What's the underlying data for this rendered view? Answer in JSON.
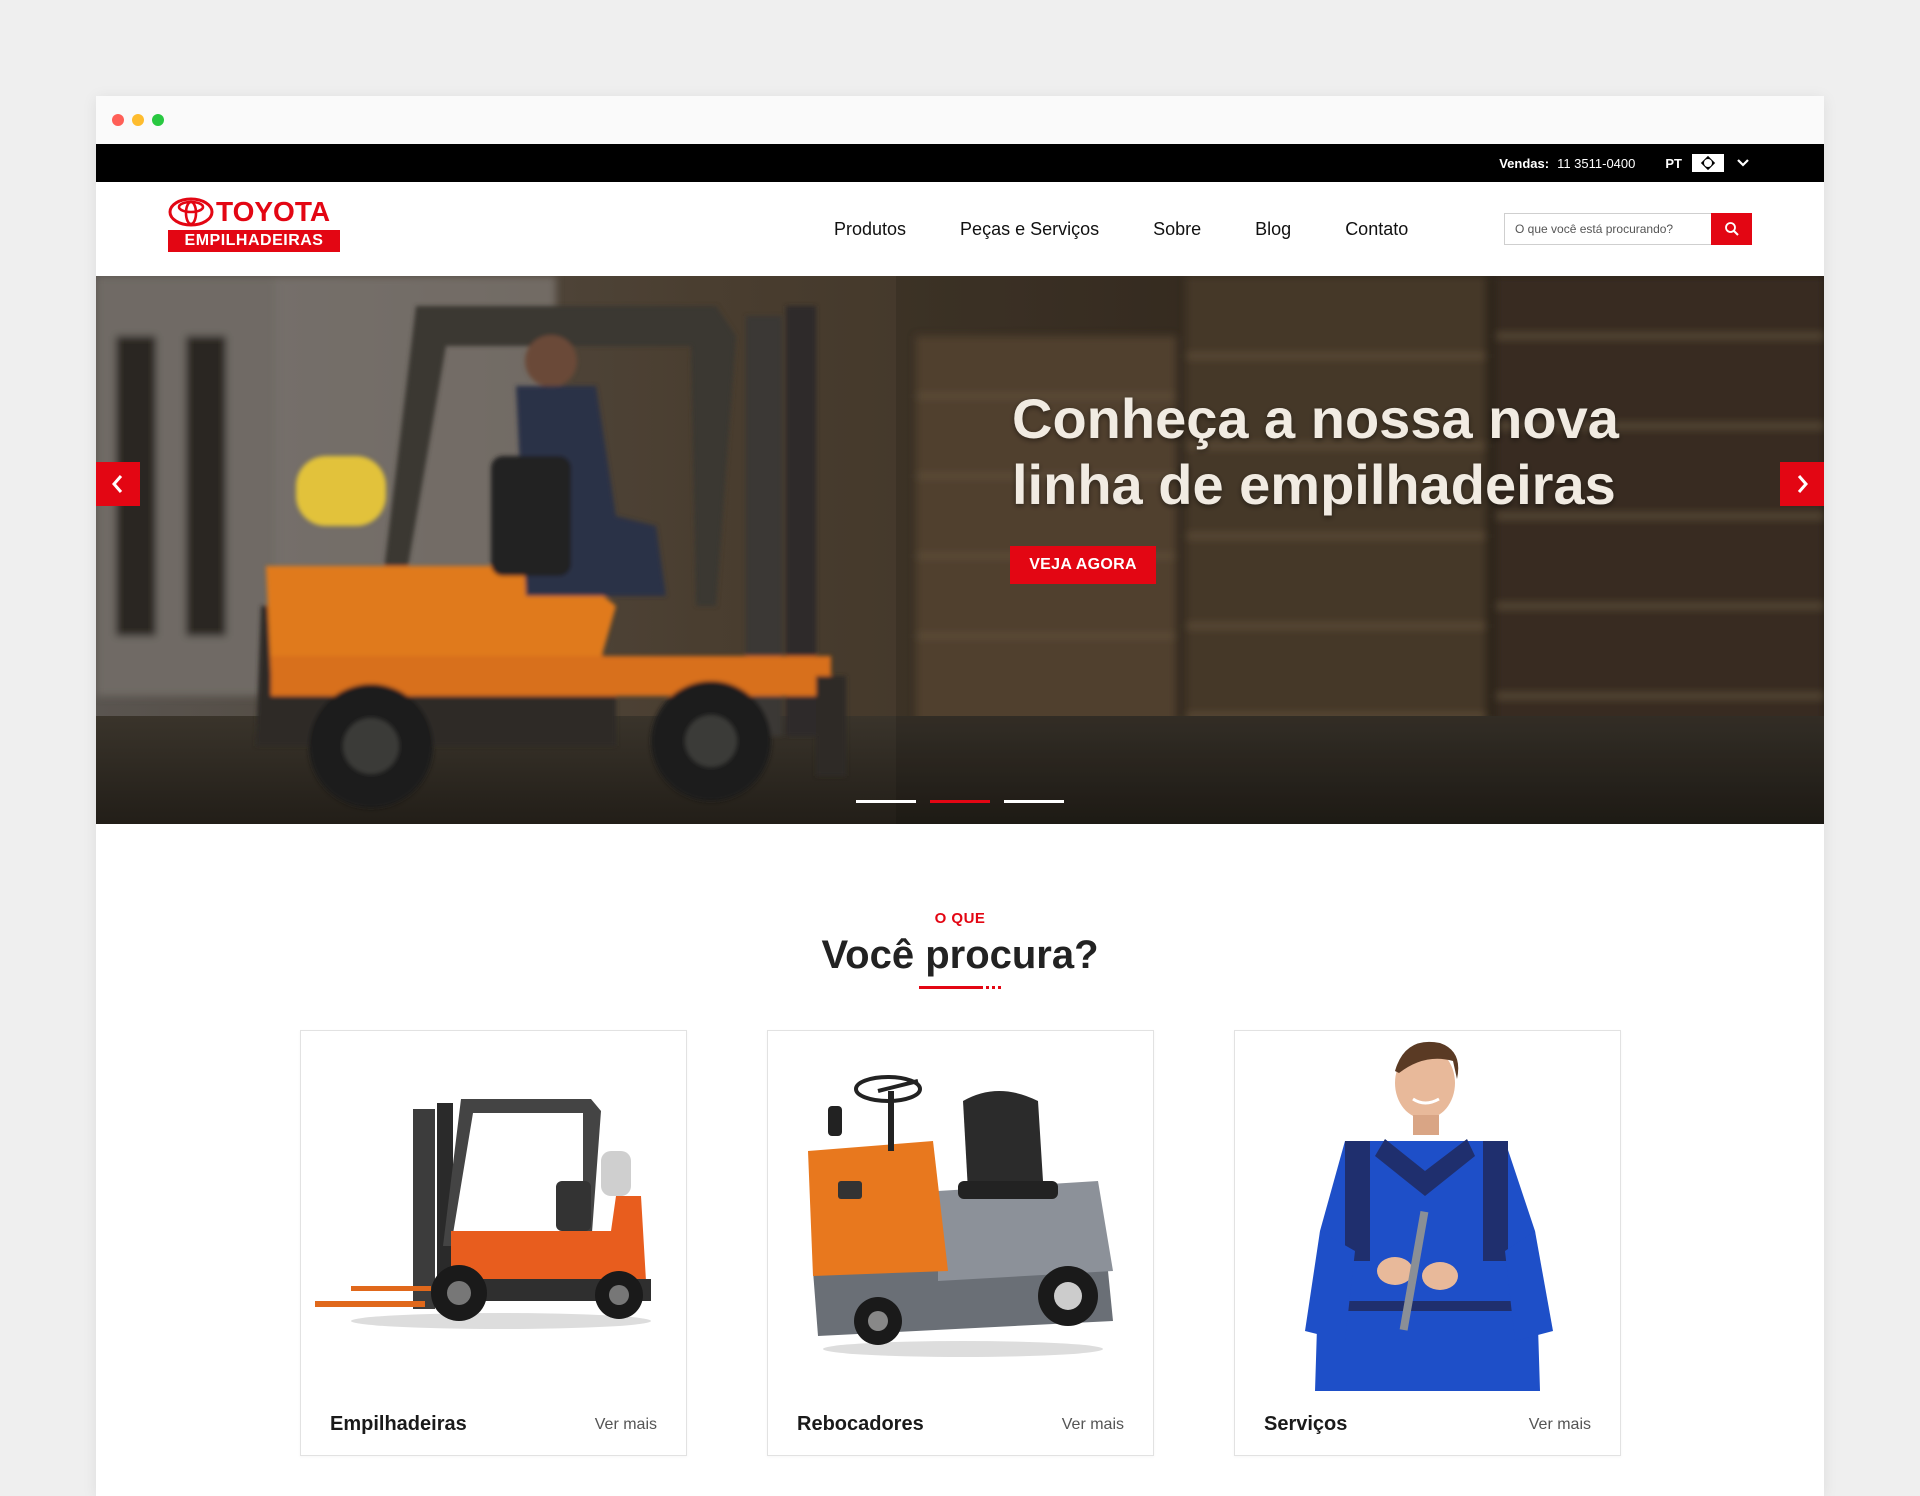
{
  "browser": {
    "dots": [
      "close",
      "minimize",
      "maximize"
    ]
  },
  "topbar": {
    "sales_label": "Vendas:",
    "sales_phone": "11 3511-0400",
    "language": "PT",
    "flag_icon": "brazil-flag-icon",
    "dropdown_icon": "chevron-down-icon"
  },
  "header": {
    "logo_word": "TOYOTA",
    "logo_sub": "EMPILHADEIRAS",
    "nav": [
      "Produtos",
      "Peças e Serviços",
      "Sobre",
      "Blog",
      "Contato"
    ],
    "search_placeholder": "O que você está procurando?",
    "search_icon": "search-icon"
  },
  "hero": {
    "title_line1": "Conheça a nossa nova",
    "title_line2": "linha de empilhadeiras",
    "cta": "VEJA AGORA",
    "prev_icon": "chevron-left-icon",
    "next_icon": "chevron-right-icon",
    "slides": 3,
    "active_slide": 2
  },
  "section": {
    "eyebrow": "O QUE",
    "title": "Você procura?"
  },
  "cards": [
    {
      "title": "Empilhadeiras",
      "link": "Ver mais"
    },
    {
      "title": "Rebocadores",
      "link": "Ver mais"
    },
    {
      "title": "Serviços",
      "link": "Ver mais"
    }
  ],
  "colors": {
    "brand_red": "#e30613",
    "topbar_bg": "#000000",
    "page_bg": "#efefef"
  }
}
